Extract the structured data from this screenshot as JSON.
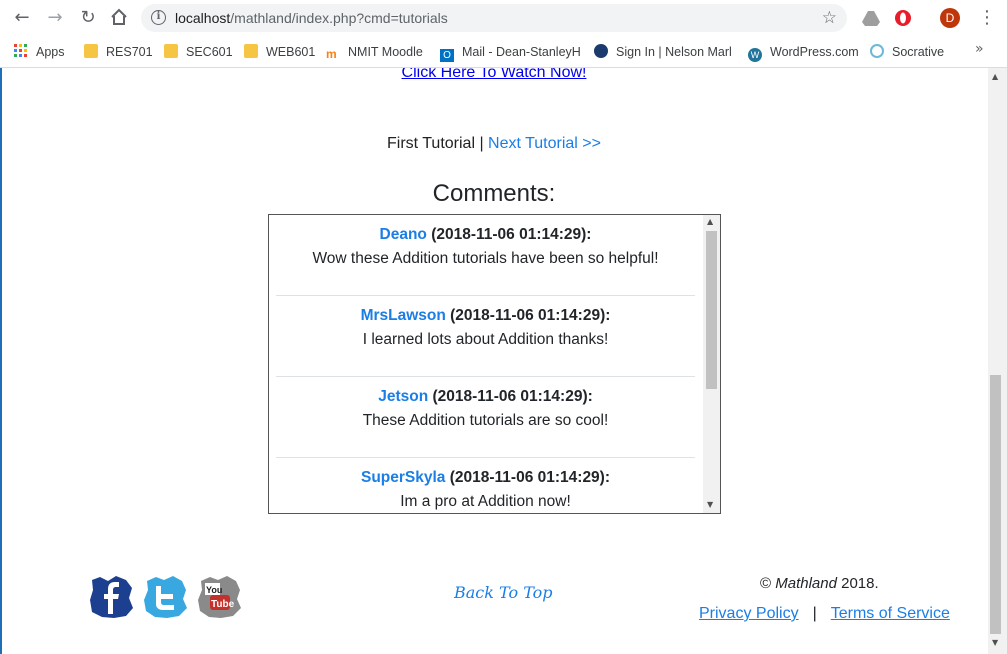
{
  "browser": {
    "url_host": "localhost",
    "url_path": "/mathland/index.php?cmd=tutorials",
    "avatar_letter": "D",
    "bookmarks": [
      {
        "label": "Apps",
        "icon": "apps-grid-icon"
      },
      {
        "label": "RES701",
        "icon": "folder-icon"
      },
      {
        "label": "SEC601",
        "icon": "folder-icon"
      },
      {
        "label": "WEB601",
        "icon": "folder-icon"
      },
      {
        "label": "NMIT Moodle",
        "icon": "moodle-icon"
      },
      {
        "label": "Mail - Dean-StanleyH",
        "icon": "outlook-icon"
      },
      {
        "label": "Sign In | Nelson Marl",
        "icon": "site-icon"
      },
      {
        "label": "WordPress.com",
        "icon": "wordpress-icon"
      },
      {
        "label": "Socrative",
        "icon": "socrative-icon"
      }
    ],
    "more_bookmarks": "»"
  },
  "page": {
    "watch_link": "Click Here To Watch Now!",
    "first_tutorial": "First Tutorial",
    "separator": " | ",
    "next_tutorial": "Next Tutorial >>",
    "comments_title": "Comments:",
    "comments": [
      {
        "author": "Deano",
        "timestamp": "(2018-11-06 01:14:29):",
        "text": "Wow these Addition tutorials have been so helpful!"
      },
      {
        "author": "MrsLawson",
        "timestamp": "(2018-11-06 01:14:29):",
        "text": "I learned lots about Addition thanks!"
      },
      {
        "author": "Jetson",
        "timestamp": "(2018-11-06 01:14:29):",
        "text": "These Addition tutorials are so cool!"
      },
      {
        "author": "SuperSkyla",
        "timestamp": "(2018-11-06 01:14:29):",
        "text": "Im a pro at Addition now!"
      }
    ],
    "back_to_top": "Back To Top",
    "copyright_symbol": "©",
    "copyright_name": "Mathland",
    "copyright_year": "2018.",
    "privacy": "Privacy Policy",
    "footer_sep": "|",
    "terms": "Terms of Service"
  },
  "colors": {
    "link": "#1a7ee6",
    "facebook": "#1d3f8f",
    "twitter": "#3aa8e0",
    "youtube": "#c4302b"
  }
}
